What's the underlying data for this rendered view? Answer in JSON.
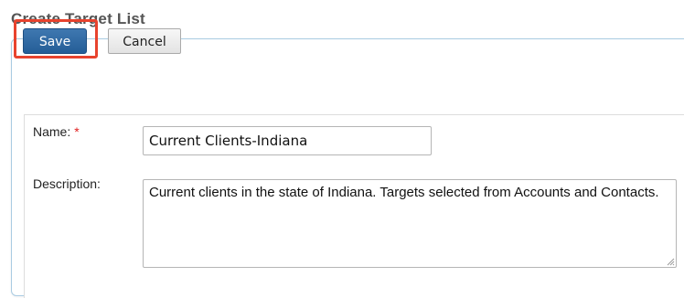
{
  "page": {
    "title": "Create Target List"
  },
  "toolbar": {
    "save_label": "Save",
    "cancel_label": "Cancel"
  },
  "form": {
    "name": {
      "label": "Name:",
      "required_marker": "*",
      "value": "Current Clients-Indiana"
    },
    "description": {
      "label": "Description:",
      "value": "Current clients in the state of Indiana. Targets selected from Accounts and Contacts."
    }
  },
  "icons": {
    "resize_grip": "resize-grip-icon"
  },
  "colors": {
    "save_button": "#2f68a3",
    "highlight": "#e8432e",
    "panel_border": "#a9cbe2",
    "required": "#e02020",
    "title_text": "#555555"
  }
}
